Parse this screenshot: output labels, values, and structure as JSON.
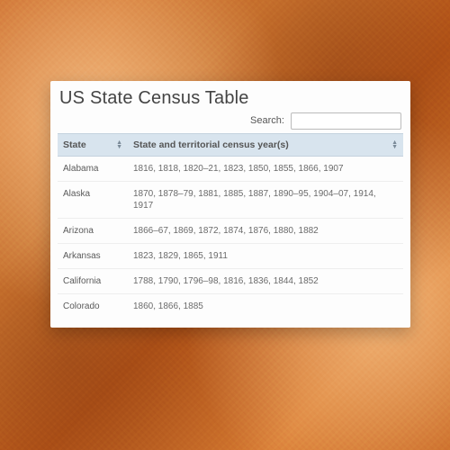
{
  "title": "US State Census Table",
  "search": {
    "label": "Search:",
    "value": "",
    "placeholder": ""
  },
  "columns": {
    "state": "State",
    "years": "State and territorial census year(s)"
  },
  "rows": [
    {
      "state": "Alabama",
      "years": "1816, 1818, 1820–21, 1823, 1850, 1855, 1866, 1907"
    },
    {
      "state": "Alaska",
      "years": "1870, 1878–79, 1881, 1885, 1887, 1890–95, 1904–07, 1914, 1917"
    },
    {
      "state": "Arizona",
      "years": "1866–67, 1869, 1872, 1874, 1876, 1880, 1882"
    },
    {
      "state": "Arkansas",
      "years": "1823, 1829, 1865, 1911"
    },
    {
      "state": "California",
      "years": "1788, 1790, 1796–98, 1816, 1836, 1844, 1852"
    },
    {
      "state": "Colorado",
      "years": "1860, 1866, 1885"
    }
  ]
}
